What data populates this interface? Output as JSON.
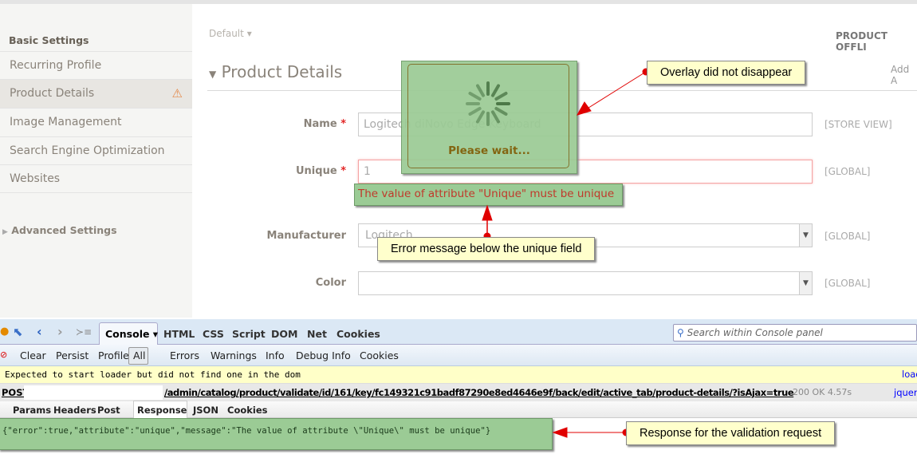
{
  "sidebar": {
    "section_basic": "Basic Settings",
    "items": [
      {
        "label": "Recurring Profile"
      },
      {
        "label": "Product Details",
        "warning_icon": "warning-icon"
      },
      {
        "label": "Image Management"
      },
      {
        "label": "Search Engine Optimization"
      },
      {
        "label": "Websites"
      }
    ],
    "section_advanced": "Advanced Settings"
  },
  "main": {
    "store_switcher": "Default",
    "offline_label": "PRODUCT OFFLI",
    "add_attr": "Add A",
    "section_title": "Product Details",
    "fields": [
      {
        "label": "Name",
        "value": "Logitech diNovo Edge Keyboard",
        "scope": "[STORE VIEW]"
      },
      {
        "label": "Unique",
        "value": "1",
        "scope": "[GLOBAL]",
        "error": "The value of attribute \"Unique\" must be unique"
      },
      {
        "label": "Manufacturer",
        "value": "Logitech",
        "scope": "[GLOBAL]"
      },
      {
        "label": "Color",
        "value": "",
        "scope": "[GLOBAL]"
      }
    ],
    "required_mark": "*",
    "loader_text": "Please wait..."
  },
  "annotations": {
    "overlay": "Overlay did not disappear",
    "error": "Error message below the unique field",
    "response": "Response for the validation request"
  },
  "firebug": {
    "tabs": [
      "Console",
      "HTML",
      "CSS",
      "Script",
      "DOM",
      "Net",
      "Cookies"
    ],
    "search_placeholder": "Search within Console panel",
    "tools": [
      "Clear",
      "Persist",
      "Profile",
      "All",
      "Errors",
      "Warnings",
      "Info",
      "Debug Info",
      "Cookies"
    ],
    "log_message": "Expected to start loader but did not find one in the dom",
    "log_source": "load",
    "request": {
      "method": "POST",
      "url": "/admin/catalog/product/validate/id/161/key/fc149321c91badf87290e8ed4646e9f/back/edit/active_tab/product-details/?isAjax=true",
      "status": "200 OK",
      "time": "4.57s",
      "source": "jquer"
    },
    "subtabs": [
      "Params",
      "Headers",
      "Post",
      "Response",
      "JSON",
      "Cookies"
    ],
    "response_body": "{\"error\":true,\"attribute\":\"unique\",\"message\":\"The value of attribute \\\"Unique\\\" must be unique\"}"
  },
  "colors": {
    "annotation_green": "#9bcb95",
    "note_yellow": "#ffffcc",
    "arrow_red": "#e00000"
  }
}
